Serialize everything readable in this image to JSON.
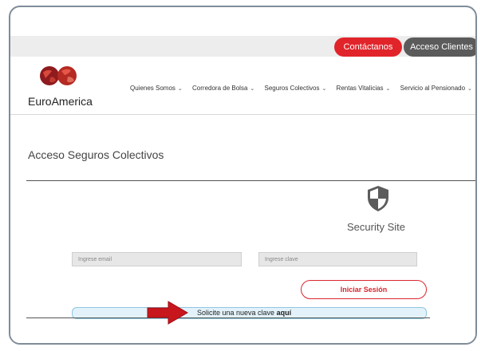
{
  "header": {
    "contact_label": "Contáctanos",
    "clients_label": "Acceso Clientes",
    "logo_text": "EuroAmerica",
    "nav": [
      {
        "label": "Quienes Somos"
      },
      {
        "label": "Corredora de Bolsa"
      },
      {
        "label": "Seguros Colectivos"
      },
      {
        "label": "Rentas Vitalicias"
      },
      {
        "label": "Servicio al Pensionado"
      }
    ]
  },
  "main": {
    "title": "Acceso Seguros Colectivos",
    "security_label": "Security Site",
    "email_placeholder": "Ingrese email",
    "password_placeholder": "Ingrese clave",
    "login_label": "Iniciar Sesión",
    "notice_text": "Solicite una nueva clave ",
    "notice_link": "aquí"
  },
  "colors": {
    "brand_red": "#e1242a",
    "dark_button": "#5b5b5b",
    "notice_bg": "#e3f2fa",
    "arrow": "#c8161d"
  },
  "icons": [
    "globe-logo-icon",
    "shield-icon",
    "chevron-down-icon",
    "red-arrow-icon"
  ]
}
